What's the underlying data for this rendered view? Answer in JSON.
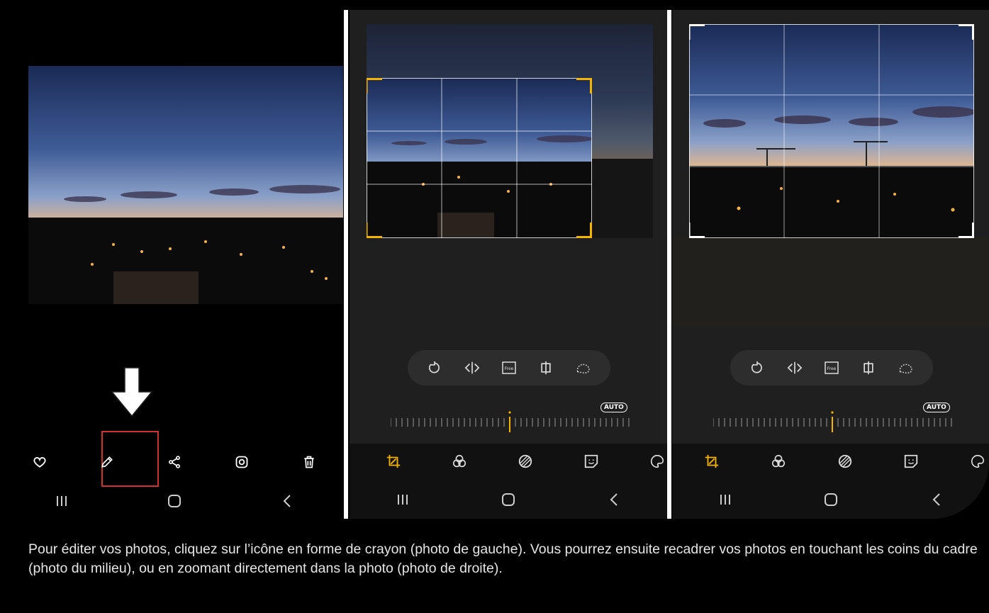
{
  "left_panel": {
    "actions": [
      {
        "icon": "heart-icon"
      },
      {
        "icon": "pencil-icon"
      },
      {
        "icon": "share-icon"
      },
      {
        "icon": "instagram-icon"
      },
      {
        "icon": "trash-icon"
      }
    ],
    "nav": [
      {
        "icon": "recents-icon"
      },
      {
        "icon": "home-icon"
      },
      {
        "icon": "back-icon"
      }
    ],
    "highlight_color": "#d32f2f"
  },
  "middle_panel": {
    "tools": [
      {
        "icon": "rotate-icon"
      },
      {
        "icon": "flip-icon"
      },
      {
        "icon": "free-aspect-icon"
      },
      {
        "icon": "perspective-icon"
      },
      {
        "icon": "lasso-icon"
      }
    ],
    "auto_label": "AUTO",
    "free_label": "Free",
    "accent": "#f5b400"
  },
  "right_panel": {
    "auto_label": "AUTO",
    "free_label": "Free"
  },
  "bottom_tabs": [
    {
      "icon": "crop-icon"
    },
    {
      "icon": "filters-icon"
    },
    {
      "icon": "tone-icon"
    },
    {
      "icon": "sticker-icon"
    },
    {
      "icon": "palette-icon"
    }
  ],
  "caption": "Pour éditer vos photos, cliquez sur l’icône en forme de crayon (photo de gauche). Vous pourrez ensuite recadrer vos photos en touchant les coins du cadre (photo du milieu), ou en zoomant directement dans la photo (photo de droite)."
}
